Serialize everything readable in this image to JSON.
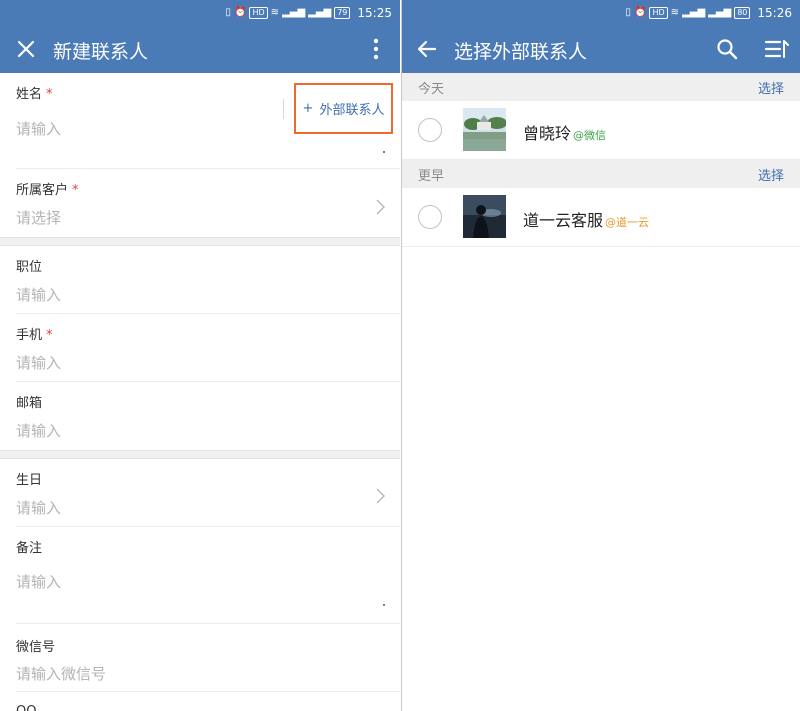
{
  "left": {
    "statusbar": {
      "battery": "79",
      "time": "15:25"
    },
    "header": {
      "title": "新建联系人"
    },
    "fields": {
      "name": {
        "label": "姓名",
        "required": "*",
        "placeholder": "请输入"
      },
      "external_button": {
        "plus": "+",
        "label": "外部联系人"
      },
      "customer": {
        "label": "所属客户",
        "required": "*",
        "placeholder": "请选择"
      },
      "position": {
        "label": "职位",
        "placeholder": "请输入"
      },
      "mobile": {
        "label": "手机",
        "required": "*",
        "placeholder": "请输入"
      },
      "email": {
        "label": "邮箱",
        "placeholder": "请输入"
      },
      "birthday": {
        "label": "生日",
        "placeholder": "请输入"
      },
      "note": {
        "label": "备注",
        "placeholder": "请输入"
      },
      "wechat": {
        "label": "微信号",
        "placeholder": "请输入微信号"
      },
      "qq": {
        "label": "QQ"
      }
    }
  },
  "right": {
    "statusbar": {
      "battery": "80",
      "time": "15:26"
    },
    "header": {
      "title": "选择外部联系人"
    },
    "sections": [
      {
        "title": "今天",
        "select_label": "选择",
        "contacts": [
          {
            "name": "曾晓玲",
            "tag": "@微信",
            "tag_color": "#3aa34a"
          }
        ]
      },
      {
        "title": "更早",
        "select_label": "选择",
        "contacts": [
          {
            "name": "道一云客服",
            "tag": "@道一云",
            "tag_color": "#e89a2c"
          }
        ]
      }
    ]
  },
  "colors": {
    "header_bg": "#4a7bb7",
    "accent_blue": "#3f6fb0",
    "required_red": "#e0413a",
    "highlight_orange": "#ec6b2a"
  }
}
